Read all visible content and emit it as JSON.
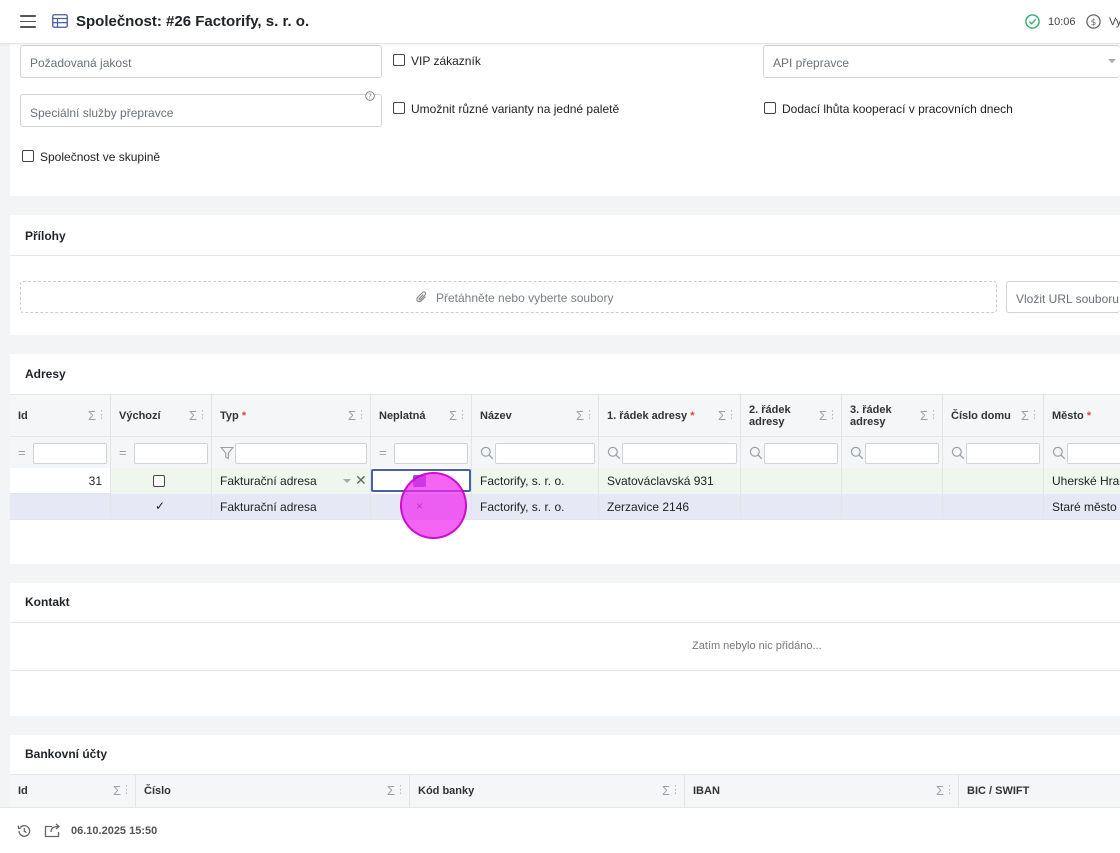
{
  "header": {
    "title": "Společnost: #26 Factorify, s. r. o.",
    "time": "10:06",
    "right_text": "Vy"
  },
  "form": {
    "required_quality_placeholder": "Požadovaná jakost",
    "special_services_placeholder": "Speciální služby přepravce",
    "carrier_api_placeholder": "API přepravce",
    "vip_label": "VIP zákazník",
    "variants_label": "Umožnit různé varianty na jedné paletě",
    "delivery_label": "Dodací lhůta kooperací v pracovních dnech",
    "group_label": "Společnost ve skupině"
  },
  "attachments": {
    "title": "Přílohy",
    "dropzone": "Přetáhněte nebo vyberte soubory",
    "url_placeholder": "Vložit URL souboru z"
  },
  "addresses": {
    "title": "Adresy",
    "columns": [
      {
        "label": "Id",
        "required": false
      },
      {
        "label": "Výchozí",
        "required": false
      },
      {
        "label": "Typ",
        "required": true
      },
      {
        "label": "Neplatná",
        "required": false
      },
      {
        "label": "Název",
        "required": false
      },
      {
        "label": "1. řádek adresy",
        "required": true
      },
      {
        "label": "2. řádek adresy",
        "required": false
      },
      {
        "label": "3. řádek adresy",
        "required": false
      },
      {
        "label": "Číslo domu",
        "required": false
      },
      {
        "label": "Město",
        "required": true
      }
    ],
    "required_mark": "*",
    "rows": [
      {
        "id": "31",
        "type": "Fakturační adresa",
        "name": "Factorify, s. r. o.",
        "line1": "Svatováclavská 931",
        "city": "Uherské Hradiště"
      },
      {
        "id": "",
        "type": "Fakturační adresa",
        "name": "Factorify, s. r. o.",
        "line1": "Zerzavice 2146",
        "city": "Staré město",
        "default_mark": "✓",
        "invalid_mark": "×"
      }
    ]
  },
  "contacts": {
    "title": "Kontakt",
    "empty": "Zatím nebylo nic přidáno..."
  },
  "bank": {
    "title": "Bankovní účty",
    "columns": [
      "Id",
      "Číslo",
      "Kód banky",
      "IBAN",
      "BIC / SWIFT"
    ]
  },
  "footer": {
    "date": "06.10.2025 15:50"
  },
  "colors": {
    "accent": "#7b5cd6",
    "ok": "#2eae6b",
    "cursor": "#e800e8",
    "required": "#e0414e",
    "row_new": "#e6e8f6",
    "row_edit": "#eef6ee"
  }
}
